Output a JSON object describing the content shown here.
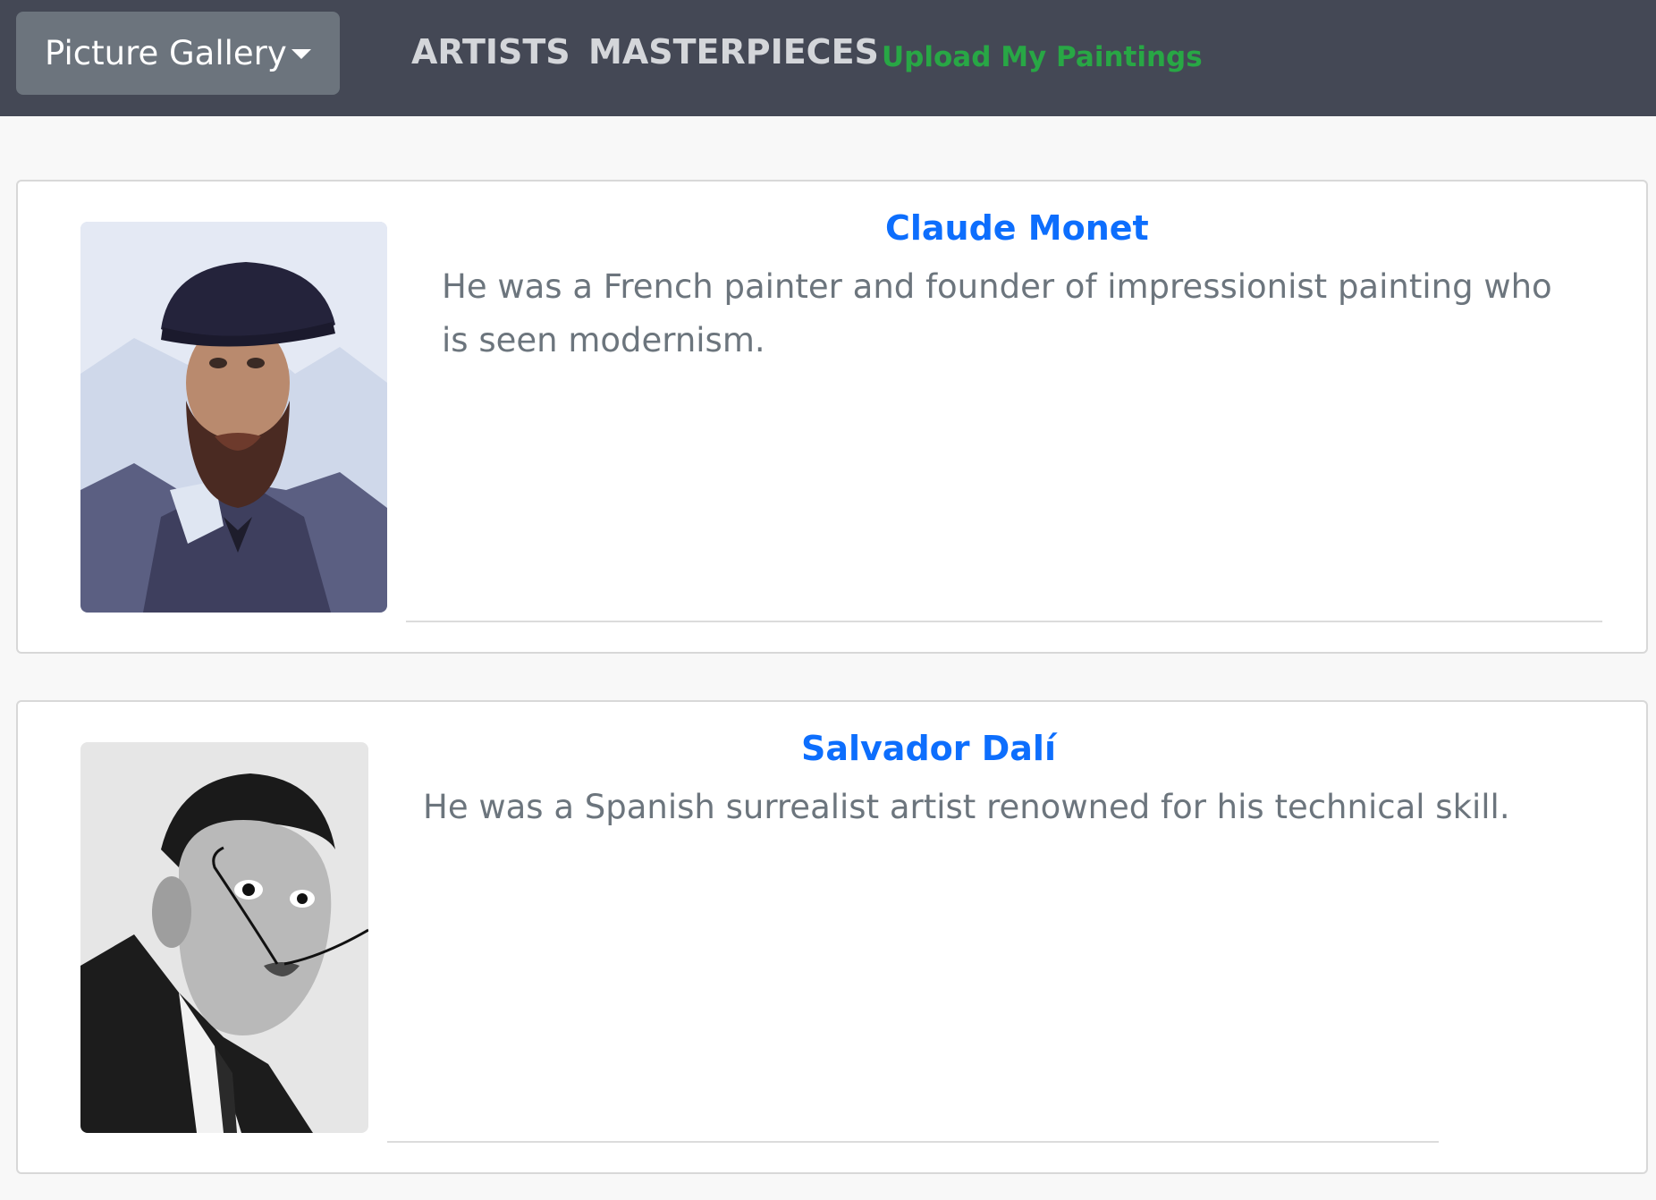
{
  "navbar": {
    "brand_label": "Picture Gallery",
    "links": [
      {
        "label": "ARTISTS"
      },
      {
        "label": "MASTERPIECES"
      }
    ],
    "upload_label": "Upload My Paintings",
    "colors": {
      "background": "#444855",
      "brand_button": "#6c747d",
      "link": "#d4d6da",
      "upload_link": "#28a745"
    }
  },
  "artists": [
    {
      "name": "Claude Monet",
      "description": "He was a French painter and founder of impressionist painting who is seen modernism."
    },
    {
      "name": "Salvador Dalí",
      "description": "He was a Spanish surrealist artist renowned for his technical skill."
    }
  ],
  "colors": {
    "artist_name": "#0d6efd",
    "description_text": "#6c757d"
  }
}
